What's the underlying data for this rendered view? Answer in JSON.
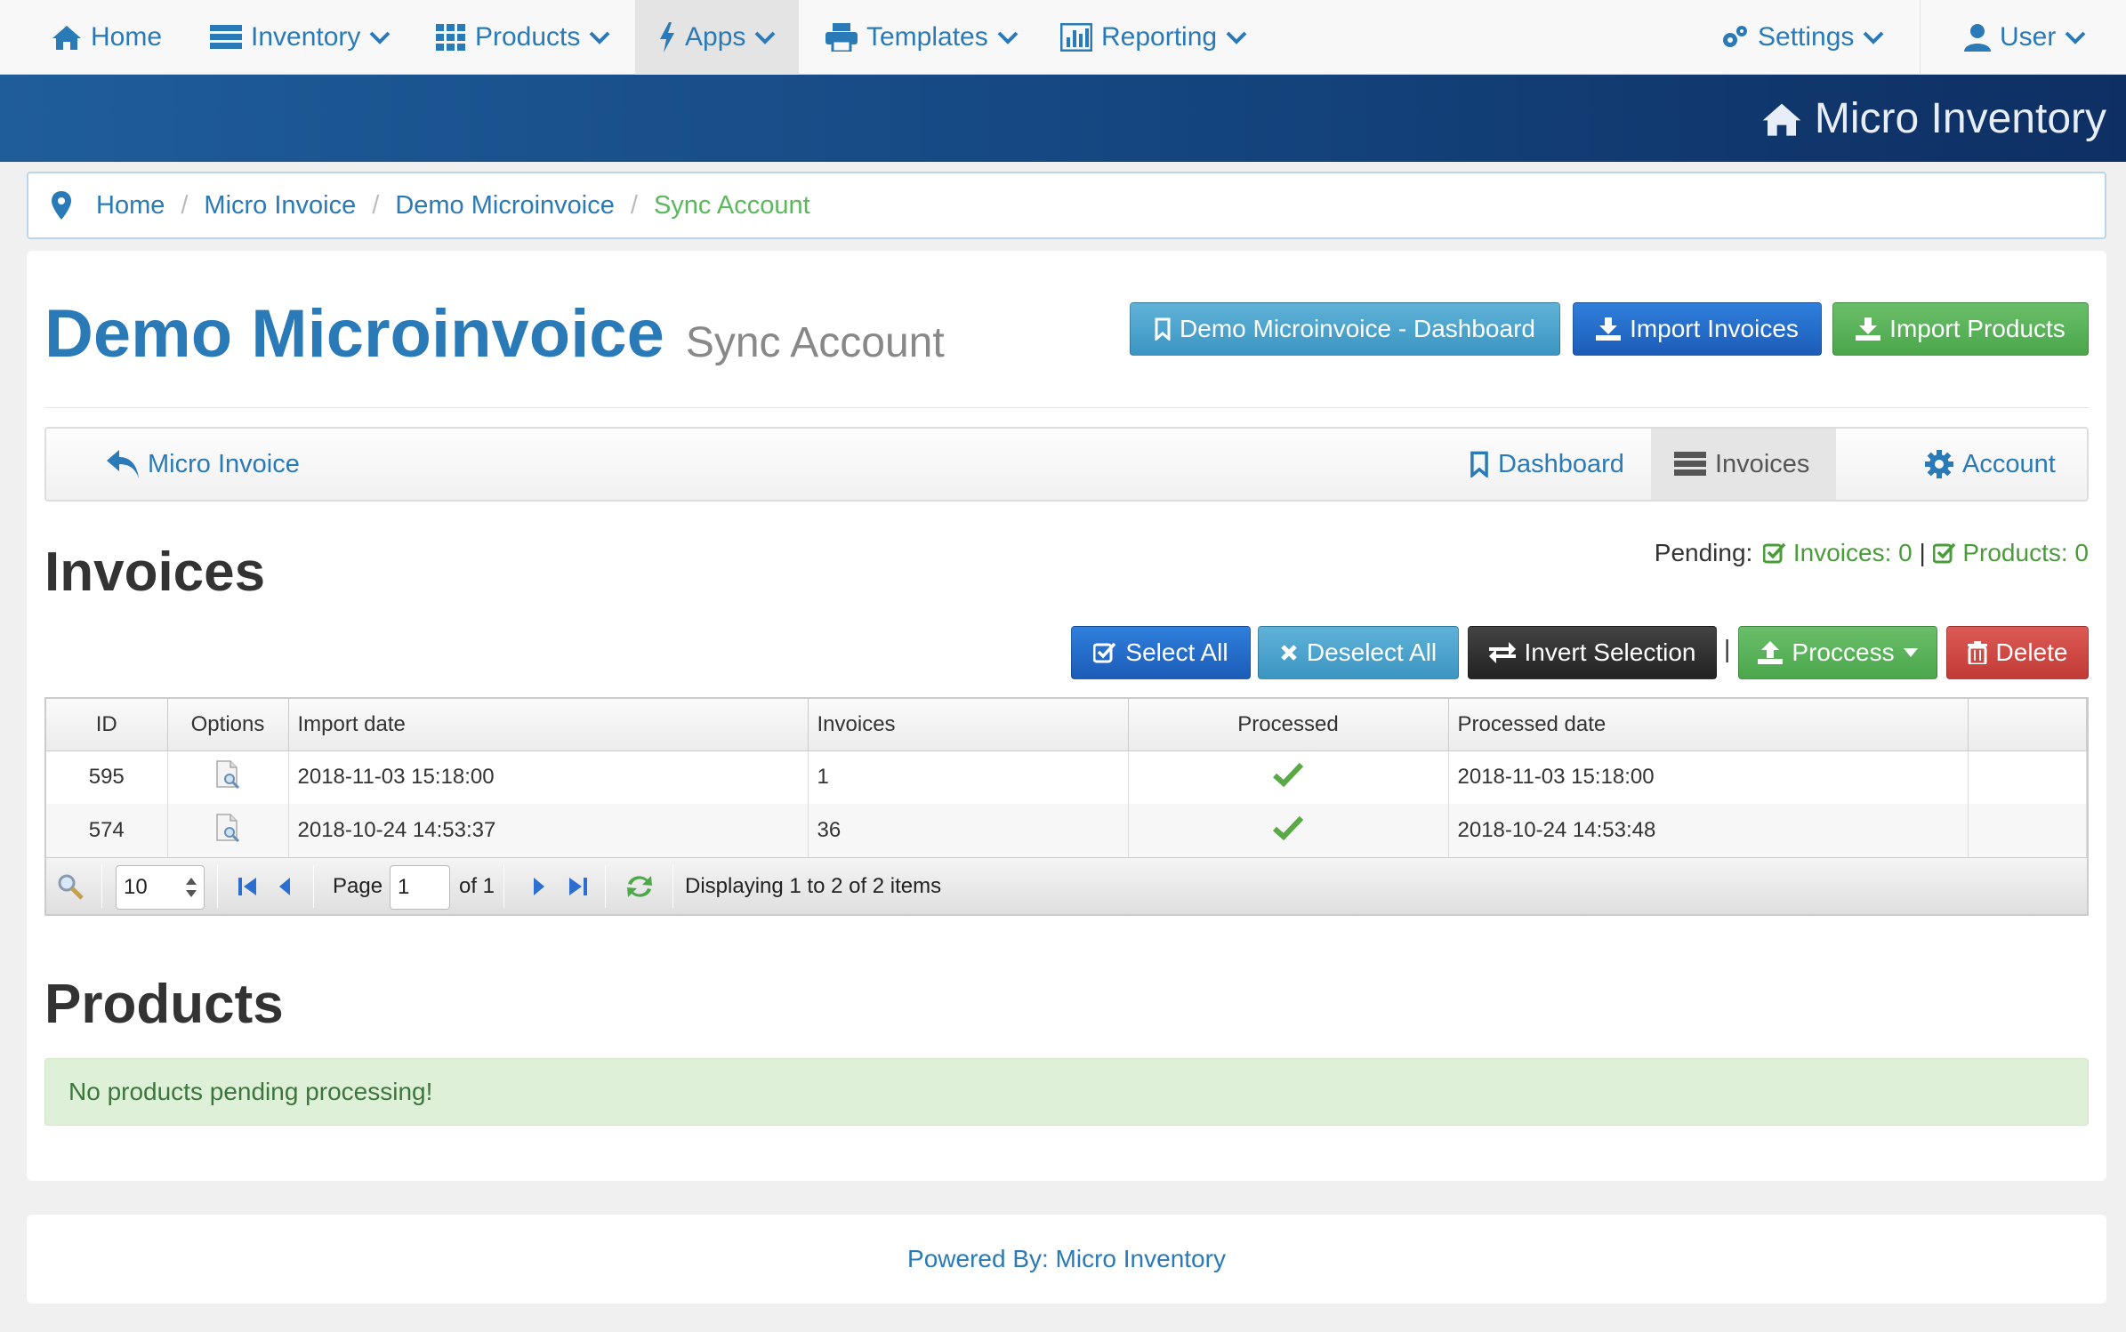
{
  "topnav": {
    "home": "Home",
    "inventory": "Inventory",
    "products": "Products",
    "apps": "Apps",
    "templates": "Templates",
    "reporting": "Reporting",
    "settings": "Settings",
    "user": "User"
  },
  "brand": "Micro Inventory",
  "breadcrumb": [
    "Home",
    "Micro Invoice",
    "Demo Microinvoice",
    "Sync Account"
  ],
  "page": {
    "title": "Demo Microinvoice",
    "subtitle": "Sync Account",
    "buttons": {
      "dashboard": "Demo Microinvoice - Dashboard",
      "import_invoices": "Import Invoices",
      "import_products": "Import Products"
    }
  },
  "subnav": {
    "back": "Micro Invoice",
    "dashboard": "Dashboard",
    "invoices": "Invoices",
    "account": "Account"
  },
  "invoices": {
    "heading": "Invoices",
    "pending_label": "Pending:",
    "pending_invoices": "Invoices: 0",
    "pending_sep": "|",
    "pending_products": "Products: 0",
    "actions": {
      "select_all": "Select All",
      "deselect_all": "Deselect All",
      "invert": "Invert Selection",
      "sep": "|",
      "process": "Proccess",
      "delete": "Delete"
    },
    "columns": [
      "ID",
      "Options",
      "Import date",
      "Invoices",
      "Processed",
      "Processed date"
    ],
    "rows": [
      {
        "id": "595",
        "import_date": "2018-11-03 15:18:00",
        "invoices": "1",
        "processed": true,
        "processed_date": "2018-11-03 15:18:00"
      },
      {
        "id": "574",
        "import_date": "2018-10-24 14:53:37",
        "invoices": "36",
        "processed": true,
        "processed_date": "2018-10-24 14:53:48"
      }
    ],
    "pager": {
      "page_size": "10",
      "page_label": "Page",
      "page_value": "1",
      "of_label": "of 1",
      "display": "Displaying 1 to 2 of 2 items"
    }
  },
  "products": {
    "heading": "Products",
    "alert": "No products pending processing!"
  },
  "footer": "Powered By: Micro Inventory",
  "colors": {
    "link": "#2a7ab8",
    "success": "#5cb85c",
    "danger": "#d9534f",
    "banner": "#164a85"
  }
}
